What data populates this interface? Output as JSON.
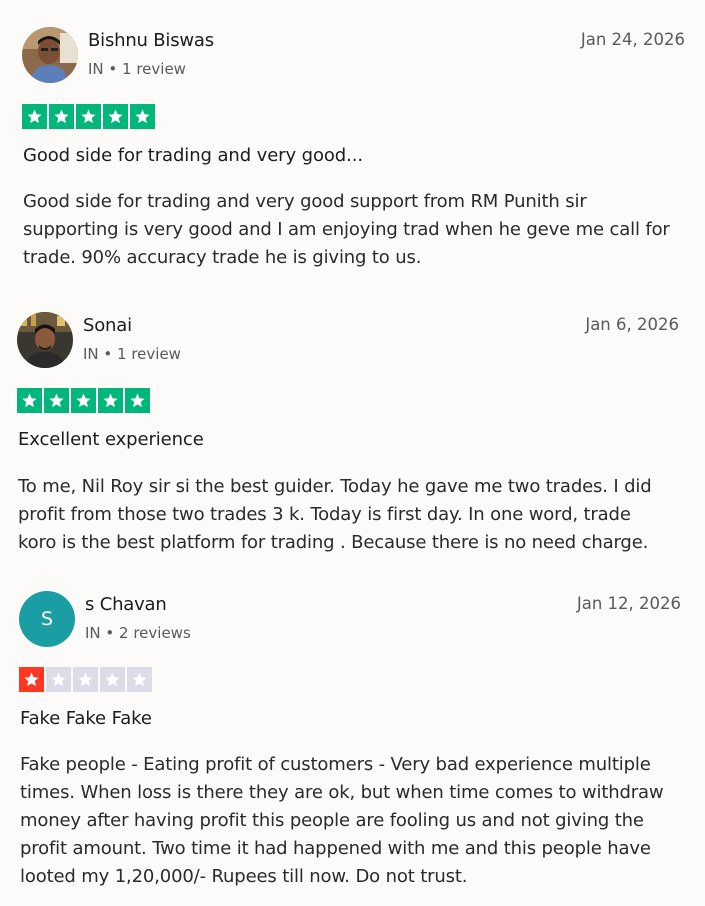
{
  "colors": {
    "star_green": "#00b67a",
    "star_red": "#ff3722",
    "star_empty": "#dcdce6",
    "avatar_teal": "#1a9ea3"
  },
  "reviews": [
    {
      "name": "Bishnu Biswas",
      "meta": "IN • 1 review",
      "date": "Jan 24, 2026",
      "rating": 5,
      "title": "Good side for trading and very good...",
      "body_lines": [
        "Good side for trading and very good support from RM Punith sir",
        "supporting is very good and I am enjoying trad when he geve me call for",
        "trade. 90% accuracy trade he is giving to us."
      ]
    },
    {
      "name": "Sonai",
      "meta": "IN • 1 review",
      "date": "Jan 6, 2026",
      "rating": 5,
      "title": "Excellent experience",
      "body_lines": [
        "To me, Nil Roy sir si the best guider. Today he gave me two trades. I did",
        "profit from those two trades 3 k. Today is first day. In one word, trade",
        "koro is the best platform for trading . Because there is no need charge."
      ]
    },
    {
      "name": "s Chavan",
      "avatar_initial": "S",
      "meta": "IN • 2 reviews",
      "date": "Jan 12, 2026",
      "rating": 1,
      "title": "Fake Fake Fake",
      "body_lines": [
        "Fake people - Eating profit of customers - Very bad experience multiple",
        "times. When loss is there they are ok, but when time comes to withdraw",
        "money after having profit this people are fooling us and not giving the",
        "profit amount. Two time it had happened with me and this people have",
        "looted my 1,20,000/- Rupees till now. Do not trust."
      ]
    }
  ]
}
